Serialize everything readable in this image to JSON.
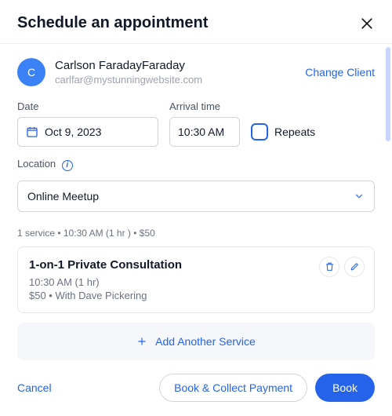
{
  "header": {
    "title": "Schedule an appointment"
  },
  "client": {
    "initial": "C",
    "name": "Carlson FaradayFaraday",
    "email": "carlfar@mystunningwebsite.com",
    "change_label": "Change Client"
  },
  "date": {
    "label": "Date",
    "value": "Oct 9, 2023"
  },
  "arrival": {
    "label": "Arrival time",
    "value": "10:30 AM"
  },
  "repeats": {
    "label": "Repeats",
    "checked": false
  },
  "location": {
    "label": "Location",
    "value": "Online Meetup"
  },
  "summary": "1 service • 10:30 AM (1 hr ) • $50",
  "service": {
    "title": "1-on-1 Private Consultation",
    "time_line": "10:30 AM  (1 hr)",
    "price_line": "$50 • With Dave Pickering"
  },
  "add_service_label": "Add Another Service",
  "footer": {
    "cancel": "Cancel",
    "collect": "Book & Collect Payment",
    "book": "Book"
  }
}
